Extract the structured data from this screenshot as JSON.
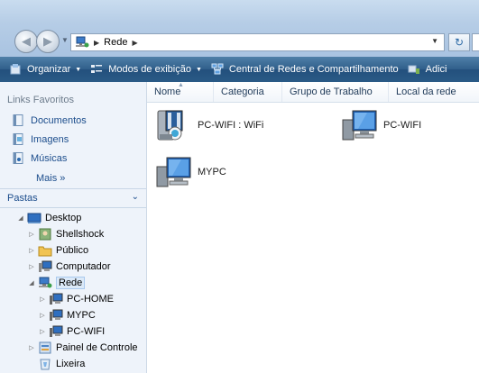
{
  "address": {
    "crumb": "Rede"
  },
  "toolbar": {
    "organize": "Organizar",
    "views": "Modos de exibição",
    "network_center": "Central de Redes e Compartilhamento",
    "add": "Adici"
  },
  "nav": {
    "favorites_header": "Links Favoritos",
    "favorites": [
      {
        "label": "Documentos",
        "icon": "documents-icon"
      },
      {
        "label": "Imagens",
        "icon": "pictures-icon"
      },
      {
        "label": "Músicas",
        "icon": "music-icon"
      }
    ],
    "more": "Mais »",
    "folders_header": "Pastas",
    "tree": [
      {
        "label": "Desktop",
        "icon": "desktop-icon"
      },
      {
        "label": "Shellshock",
        "icon": "user-folder-icon"
      },
      {
        "label": "Público",
        "icon": "folder-icon"
      },
      {
        "label": "Computador",
        "icon": "computer-icon"
      },
      {
        "label": "Rede",
        "icon": "network-icon"
      },
      {
        "label": "PC-HOME",
        "icon": "computer-icon"
      },
      {
        "label": "MYPC",
        "icon": "computer-icon"
      },
      {
        "label": "PC-WIFI",
        "icon": "computer-icon"
      },
      {
        "label": "Painel de Controle",
        "icon": "control-panel-icon"
      },
      {
        "label": "Lixeira",
        "icon": "recycle-bin-icon"
      }
    ]
  },
  "columns": [
    "Nome",
    "Categoria",
    "Grupo de Trabalho",
    "Local da rede"
  ],
  "items": [
    {
      "label": "PC-WIFI : WiFi",
      "icon": "media-device-icon"
    },
    {
      "label": "PC-WIFI",
      "icon": "computer-icon"
    },
    {
      "label": "MYPC",
      "icon": "computer-icon"
    }
  ],
  "colors": {
    "accent": "#1c4d8c",
    "commandbar": "#2a5a86"
  }
}
